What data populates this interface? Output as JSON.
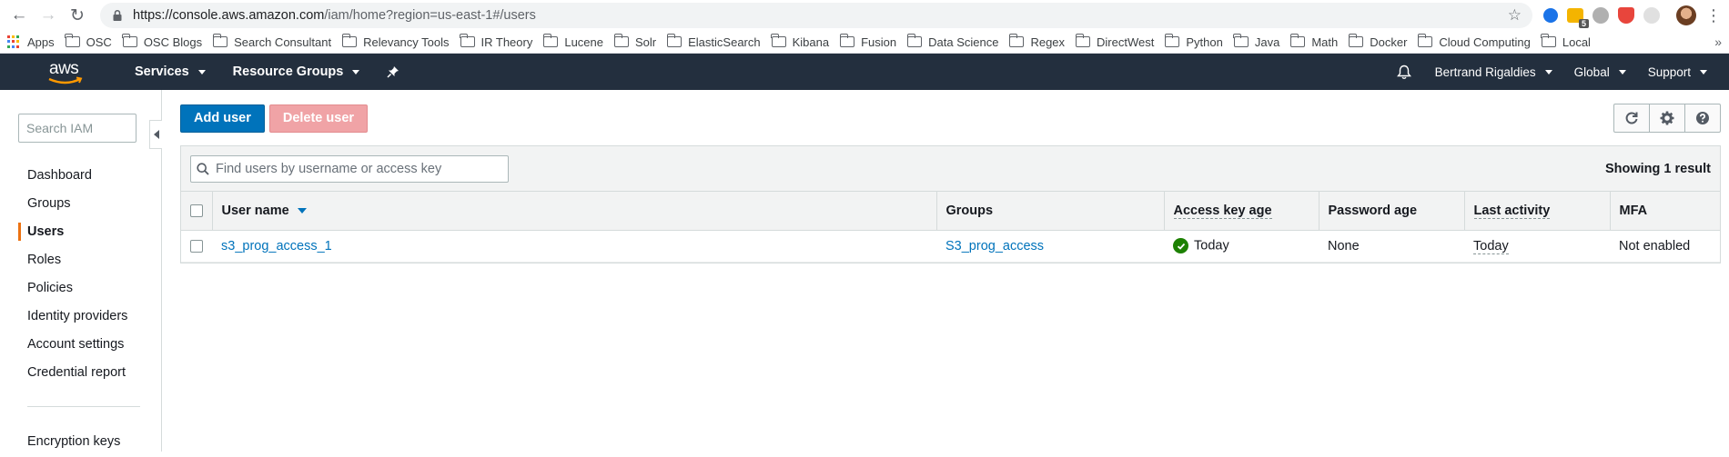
{
  "browser": {
    "url_main": "https://console.aws.amazon.com",
    "url_path": "/iam/home?region=us-east-1#/users",
    "bookmarks": [
      {
        "label": "Apps",
        "type": "apps"
      },
      {
        "label": "OSC",
        "type": "folder"
      },
      {
        "label": "OSC Blogs",
        "type": "folder"
      },
      {
        "label": "Search Consultant",
        "type": "folder"
      },
      {
        "label": "Relevancy Tools",
        "type": "folder"
      },
      {
        "label": "IR Theory",
        "type": "folder"
      },
      {
        "label": "Lucene",
        "type": "folder"
      },
      {
        "label": "Solr",
        "type": "folder"
      },
      {
        "label": "ElasticSearch",
        "type": "folder"
      },
      {
        "label": "Kibana",
        "type": "folder"
      },
      {
        "label": "Fusion",
        "type": "folder"
      },
      {
        "label": "Data Science",
        "type": "folder"
      },
      {
        "label": "Regex",
        "type": "folder"
      },
      {
        "label": "DirectWest",
        "type": "folder"
      },
      {
        "label": "Python",
        "type": "folder"
      },
      {
        "label": "Java",
        "type": "folder"
      },
      {
        "label": "Math",
        "type": "folder"
      },
      {
        "label": "Docker",
        "type": "folder"
      },
      {
        "label": "Cloud Computing",
        "type": "folder"
      },
      {
        "label": "Local",
        "type": "folder"
      }
    ],
    "ext_badge": "5",
    "overflow": "»"
  },
  "awsnav": {
    "logo": "aws",
    "services": "Services",
    "resource_groups": "Resource Groups",
    "user": "Bertrand Rigaldies",
    "region": "Global",
    "support": "Support"
  },
  "sidebar": {
    "search_placeholder": "Search IAM",
    "items": [
      {
        "label": "Dashboard",
        "name": "dashboard",
        "active": false
      },
      {
        "label": "Groups",
        "name": "groups",
        "active": false
      },
      {
        "label": "Users",
        "name": "users",
        "active": true
      },
      {
        "label": "Roles",
        "name": "roles",
        "active": false
      },
      {
        "label": "Policies",
        "name": "policies",
        "active": false
      },
      {
        "label": "Identity providers",
        "name": "identity-providers",
        "active": false
      },
      {
        "label": "Account settings",
        "name": "account-settings",
        "active": false
      },
      {
        "label": "Credential report",
        "name": "credential-report",
        "active": false
      }
    ],
    "extra_items": [
      {
        "label": "Encryption keys",
        "name": "encryption-keys"
      }
    ]
  },
  "toolbar": {
    "add_user": "Add user",
    "delete_user": "Delete user"
  },
  "table": {
    "filter_placeholder": "Find users by username or access key",
    "result_count": "Showing 1 result",
    "columns": [
      "User name",
      "Groups",
      "Access key age",
      "Password age",
      "Last activity",
      "MFA"
    ],
    "rows": [
      {
        "user_name": "s3_prog_access_1",
        "groups": "S3_prog_access",
        "access_key_age": "Today",
        "password_age": "None",
        "last_activity": "Today",
        "mfa": "Not enabled"
      }
    ]
  },
  "colors": {
    "aws_nav": "#232f3e",
    "primary": "#0073bb",
    "accent_orange": "#ec7211",
    "success": "#1d8102"
  }
}
